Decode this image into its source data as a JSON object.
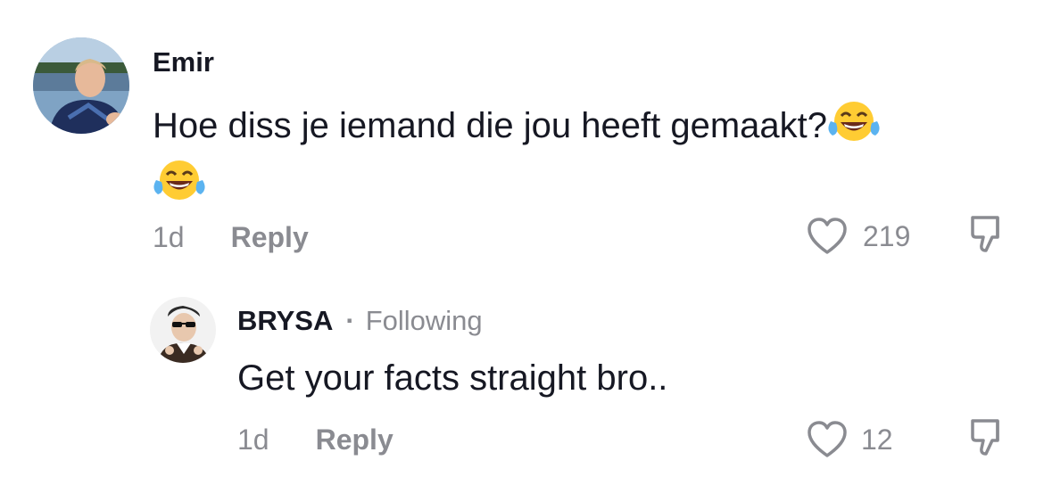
{
  "comments": [
    {
      "username": "Emir",
      "text": "Hoe diss je iemand die jou heeft gemaakt?",
      "emoji": "face-with-tears-of-joy-icon",
      "time": "1d",
      "reply_label": "Reply",
      "like_count": "219"
    }
  ],
  "replies": [
    {
      "username": "BRYSA",
      "separator": "·",
      "status": "Following",
      "text": "Get your facts straight bro..",
      "time": "1d",
      "reply_label": "Reply",
      "like_count": "12"
    }
  ],
  "colors": {
    "text_primary": "#161823",
    "text_secondary": "#8a8b91",
    "background": "#ffffff"
  },
  "icons": [
    "heart-outline-icon",
    "dislike-icon",
    "face-with-tears-of-joy-icon"
  ]
}
